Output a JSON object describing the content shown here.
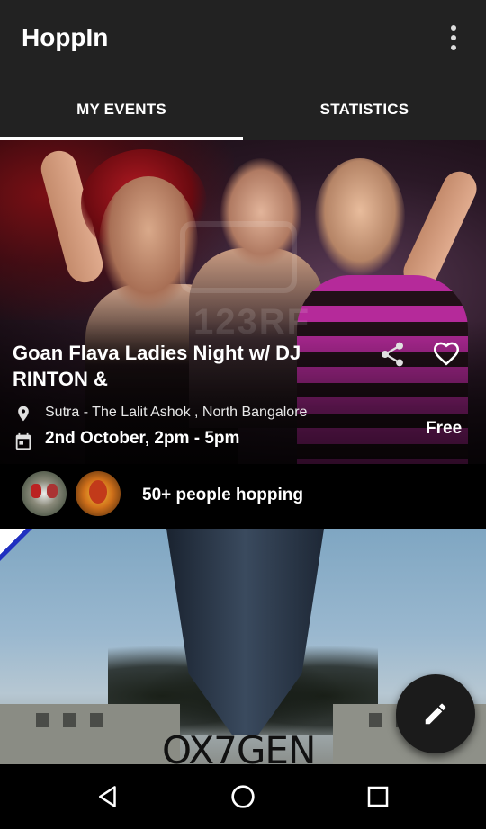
{
  "app": {
    "title": "HoppIn"
  },
  "tabs": [
    {
      "label": "MY EVENTS",
      "selected": true
    },
    {
      "label": "STATISTICS",
      "selected": false
    }
  ],
  "events": [
    {
      "title": "Goan Flava Ladies Night w/ DJ RINTON &",
      "venue": "Sutra - The Lalit Ashok , North Bangalore",
      "date": "2nd October, 2pm - 5pm",
      "price": "Free",
      "hopping": "50+ people hopping"
    },
    {
      "banner_text": "OX7GEN"
    }
  ],
  "icons": {
    "overflow": "more-vert-icon",
    "share": "share-icon",
    "favorite": "heart-outline-icon",
    "location": "location-pin-icon",
    "calendar": "calendar-icon",
    "fab": "pencil-icon",
    "nav_back": "back-triangle-icon",
    "nav_home": "home-circle-icon",
    "nav_recent": "recent-square-icon"
  },
  "colors": {
    "appbar": "#222222",
    "background": "#000000",
    "text": "#ffffff",
    "tab_indicator": "#ffffff",
    "fab": "#1b1b1b"
  }
}
